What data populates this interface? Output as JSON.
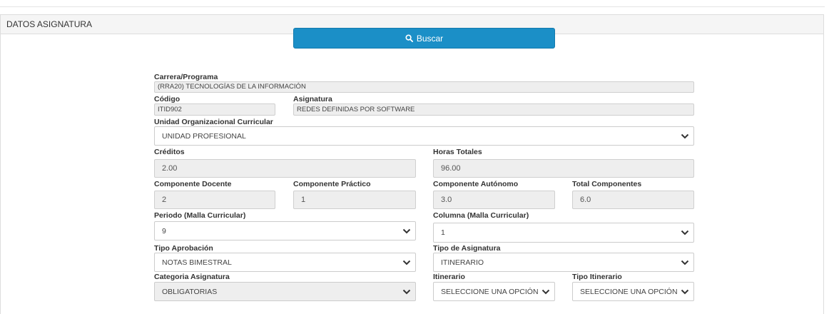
{
  "panel": {
    "title": "DATOS ASIGNATURA"
  },
  "search": {
    "label": "Buscar",
    "icon": "search-icon"
  },
  "carrera": {
    "label": "Carrera/Programa",
    "value": "(RRA20) TECNOLOGÍAS DE LA INFORMACIÓN"
  },
  "codigo": {
    "label": "Código",
    "value": "ITID902"
  },
  "asignatura": {
    "label": "Asignatura",
    "value": "REDES DEFINIDAS POR SOFTWARE"
  },
  "unidad": {
    "label": "Unidad Organizacional Curricular",
    "value": "UNIDAD PROFESIONAL"
  },
  "creditos": {
    "label": "Créditos",
    "value": "2.00"
  },
  "horas": {
    "label": "Horas Totales",
    "value": "96.00"
  },
  "comp_docente": {
    "label": "Componente Docente",
    "value": "2"
  },
  "comp_practico": {
    "label": "Componente Práctico",
    "value": "1"
  },
  "comp_autonomo": {
    "label": "Componente Autónomo",
    "value": "3.0"
  },
  "total_comp": {
    "label": "Total Componentes",
    "value": "6.0"
  },
  "periodo": {
    "label": "Periodo (Malla Curricular)",
    "value": "9"
  },
  "columna": {
    "label": "Columna (Malla Curricular)",
    "value": "1"
  },
  "tipo_aprobacion": {
    "label": "Tipo Aprobación",
    "value": "NOTAS BIMESTRAL"
  },
  "tipo_asignatura": {
    "label": "Tipo de Asignatura",
    "value": "ITINERARIO"
  },
  "categoria": {
    "label": "Categoria Asignatura",
    "value": "OBLIGATORIAS"
  },
  "itinerario": {
    "label": "Itinerario",
    "value": "SELECCIONE UNA OPCIÓN"
  },
  "tipo_itinerario": {
    "label": "Tipo Itinerario",
    "value": "SELECCIONE UNA OPCIÓN"
  },
  "colors": {
    "primary": "#1b8fc7",
    "readonly_bg": "#eeeeee",
    "header_bg": "#f5f5f5"
  }
}
